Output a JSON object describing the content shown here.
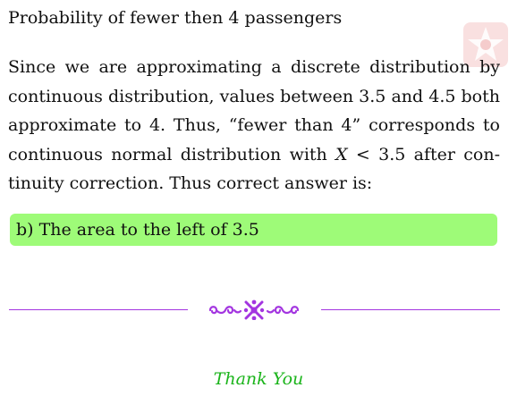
{
  "heading": "Probability of fewer then 4 passengers",
  "paragraph": {
    "l1": "Since we are approximating a discrete distribution by",
    "l2": "continuous distribution, values between 3.5 and 4.5 both",
    "l3": "approximate to 4.  Thus, “fewer than 4” corresponds to",
    "l4_pre": "continuous normal distribution with ",
    "l4_var": "X",
    "l4_post": " < 3.5 after con-",
    "l5": "tinuity correction. Thus correct answer is:"
  },
  "answer": "b) The area to the left of 3.5",
  "closing": "Thank You",
  "colors": {
    "answer_background": "#9efb78",
    "divider": "#a335e0",
    "thank_you": "#1bb41b",
    "watermark": "#f4c6c6"
  },
  "icons": {
    "divider_ornament": "swirl-ornament-icon",
    "watermark": "star-badge-icon"
  }
}
